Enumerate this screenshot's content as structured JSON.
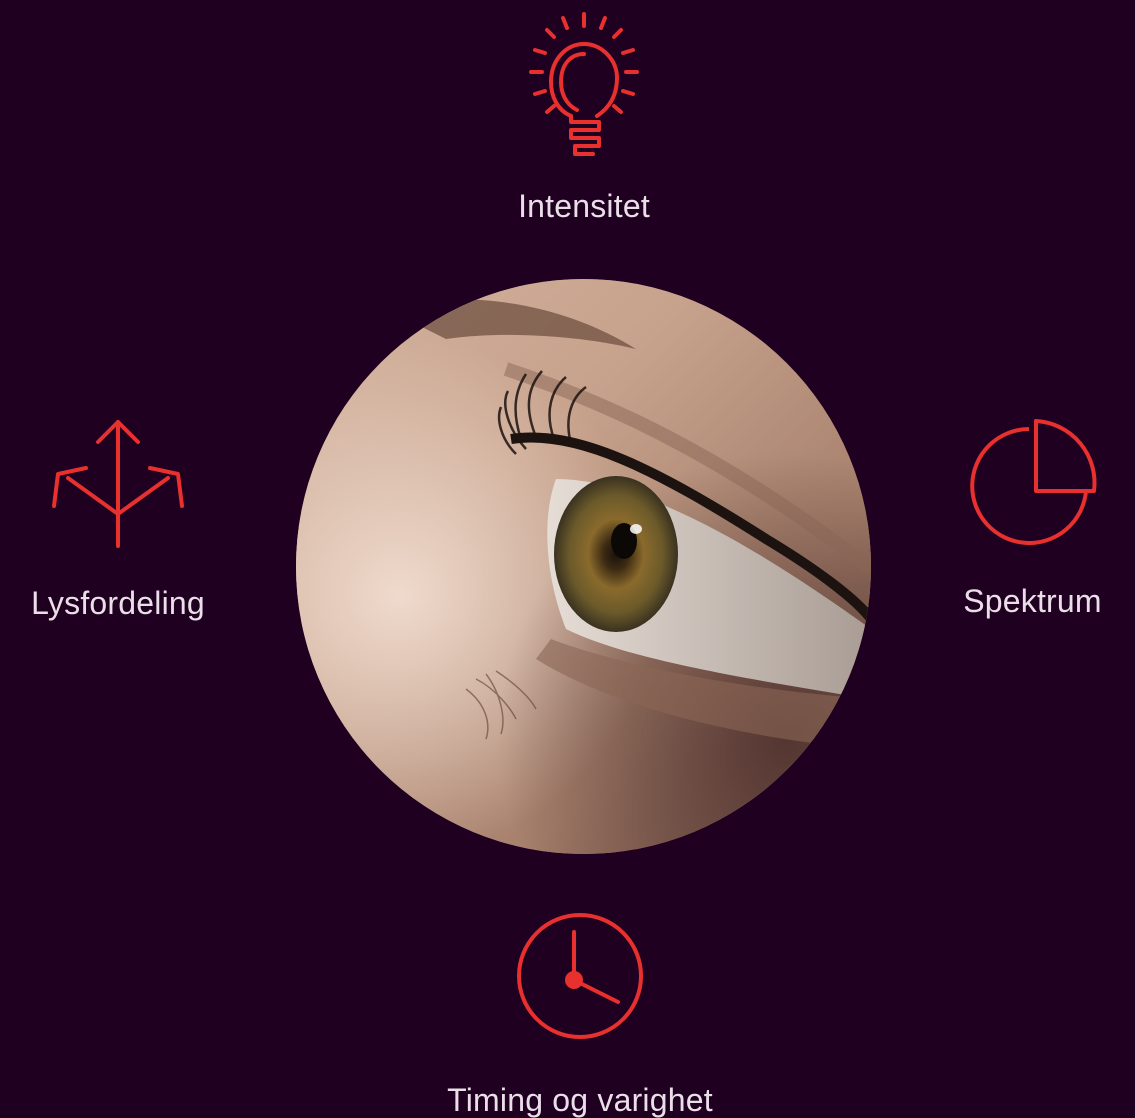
{
  "colors": {
    "background": "#200020",
    "accent": "#e8302e",
    "label": "#eadfe8"
  },
  "features": {
    "intensity": {
      "label": "Intensitet",
      "icon": "light-bulb-icon"
    },
    "distribution": {
      "label": "Lysfordeling",
      "icon": "distribution-arrows-icon"
    },
    "spectrum": {
      "label": "Spektrum",
      "icon": "pie-chart-icon"
    },
    "timing": {
      "label": "Timing og varighet",
      "icon": "clock-icon"
    }
  },
  "photo": {
    "subject": "close-up-eye-photo"
  }
}
